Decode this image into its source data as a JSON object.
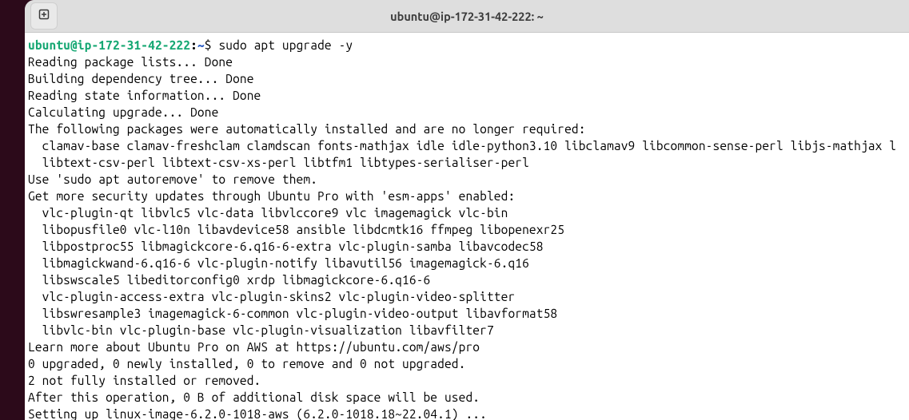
{
  "window": {
    "title": "ubuntu@ip-172-31-42-222: ~"
  },
  "prompt": {
    "user_host": "ubuntu@ip-172-31-42-222",
    "colon": ":",
    "path": "~",
    "dollar": "$ ",
    "command": "sudo apt upgrade -y"
  },
  "output": [
    "Reading package lists... Done",
    "Building dependency tree... Done",
    "Reading state information... Done",
    "Calculating upgrade... Done",
    "The following packages were automatically installed and are no longer required:",
    "  clamav-base clamav-freshclam clamdscan fonts-mathjax idle idle-python3.10 libclamav9 libcommon-sense-perl libjs-mathjax l",
    "  libtext-csv-perl libtext-csv-xs-perl libtfm1 libtypes-serialiser-perl",
    "Use 'sudo apt autoremove' to remove them.",
    "Get more security updates through Ubuntu Pro with 'esm-apps' enabled:",
    "  vlc-plugin-qt libvlc5 vlc-data libvlccore9 vlc imagemagick vlc-bin",
    "  libopusfile0 vlc-l10n libavdevice58 ansible libdcmtk16 ffmpeg libopenexr25",
    "  libpostproc55 libmagickcore-6.q16-6-extra vlc-plugin-samba libavcodec58",
    "  libmagickwand-6.q16-6 vlc-plugin-notify libavutil56 imagemagick-6.q16",
    "  libswscale5 libeditorconfig0 xrdp libmagickcore-6.q16-6",
    "  vlc-plugin-access-extra vlc-plugin-skins2 vlc-plugin-video-splitter",
    "  libswresample3 imagemagick-6-common vlc-plugin-video-output libavformat58",
    "  libvlc-bin vlc-plugin-base vlc-plugin-visualization libavfilter7",
    "Learn more about Ubuntu Pro on AWS at https://ubuntu.com/aws/pro",
    "0 upgraded, 0 newly installed, 0 to remove and 0 not upgraded.",
    "2 not fully installed or removed.",
    "After this operation, 0 B of additional disk space will be used.",
    "Setting up linux-image-6.2.0-1018-aws (6.2.0-1018.18~22.04.1) ..."
  ]
}
